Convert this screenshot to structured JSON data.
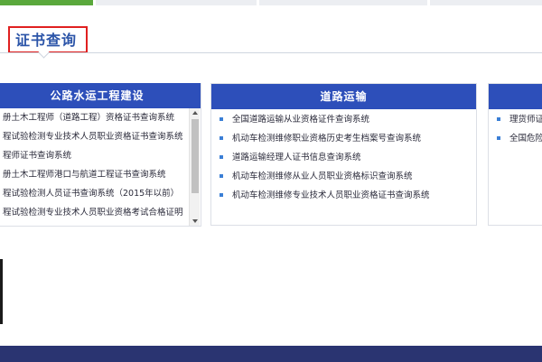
{
  "top_tabs": [
    {
      "active": true
    },
    {
      "active": false
    },
    {
      "active": false
    },
    {
      "active": false
    }
  ],
  "page_title": "证书查询",
  "panels": {
    "left": {
      "title": "公路水运工程建设",
      "items": [
        "册土木工程师（道路工程）资格证书查询系统",
        "程试验检测专业技术人员职业资格证书查询系统",
        "程师证书查询系统",
        "册土木工程师港口与航道工程证书查询系统",
        "程试验检测人员证书查询系统（2015年以前）",
        "程试验检测专业技术人员职业资格考试合格证明"
      ]
    },
    "middle": {
      "title": "道路运输",
      "items": [
        "全国道路运输从业资格证件查询系统",
        "机动车检测维修职业资格历史考生档案号查询系统",
        "道路运输经理人证书信息查询系统",
        "机动车检测维修从业人员职业资格标识查询系统",
        "机动车检测维修专业技术人员职业资格证书查询系统"
      ]
    },
    "right": {
      "title": "",
      "items": [
        "理货师证",
        "全国危险"
      ]
    }
  },
  "colors": {
    "accent_blue": "#2d4fba",
    "title_blue": "#2b54a8",
    "highlight_red": "#e02020",
    "active_tab_green": "#5aa83c",
    "footer_navy": "#2a3471"
  }
}
